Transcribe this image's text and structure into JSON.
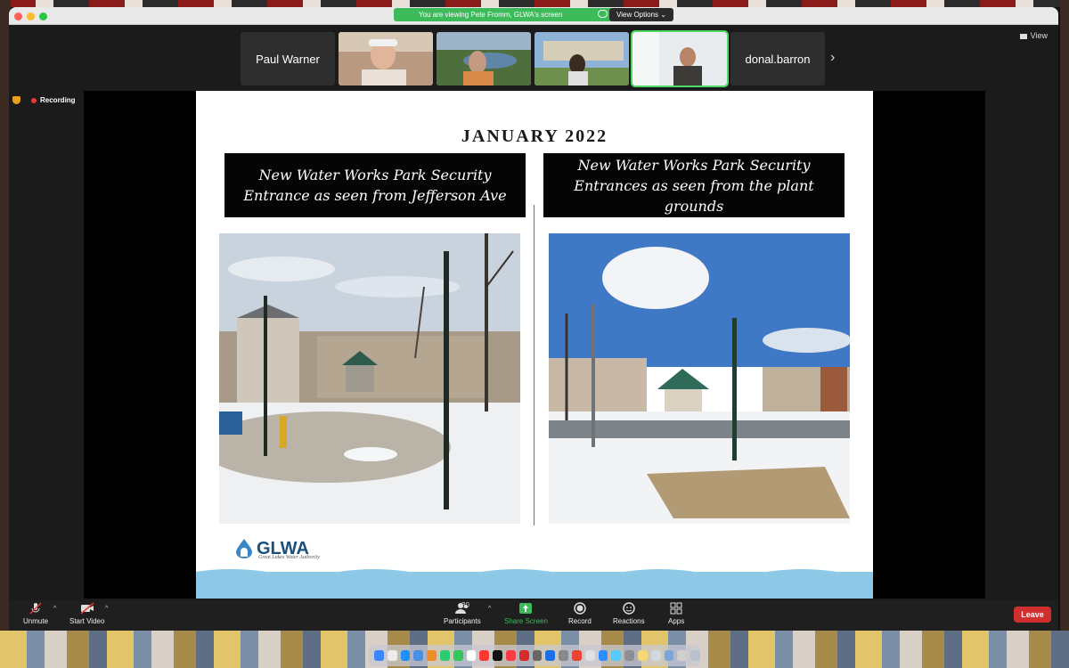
{
  "screen_share": {
    "banner_text": "You are viewing Pete Fromm, GLWA's screen",
    "view_options_label": "View Options ⌄"
  },
  "participants": [
    {
      "type": "name",
      "label": "Paul Warner"
    },
    {
      "type": "video",
      "label": ""
    },
    {
      "type": "video",
      "label": ""
    },
    {
      "type": "video",
      "label": ""
    },
    {
      "type": "video",
      "label": "",
      "active": true
    },
    {
      "type": "name",
      "label": "donal.barron"
    }
  ],
  "view_label": "View",
  "recording_label": "Recording",
  "slide": {
    "title": "JANUARY 2022",
    "left_caption_line1": "New Water Works Park Security",
    "left_caption_line2": "Entrance as seen from Jefferson Ave",
    "right_caption_line1": "New Water Works Park Security",
    "right_caption_line2": "Entrances as seen from the plant grounds",
    "logo_text": "GLWA",
    "logo_subtitle": "Great Lakes Water Authority"
  },
  "toolbar": {
    "unmute": "Unmute",
    "start_video": "Start Video",
    "participants": "Participants",
    "participant_count": "30",
    "share_screen": "Share Screen",
    "record": "Record",
    "reactions": "Reactions",
    "apps": "Apps",
    "leave": "Leave"
  },
  "colors": {
    "share_green": "#3dbb5b",
    "leave_red": "#d12f2f",
    "glwa_blue": "#1c4f7a",
    "slide_wave": "#8dc9e6"
  },
  "icons": [
    "microphone-muted-icon",
    "video-off-icon",
    "participants-icon",
    "share-screen-icon",
    "record-icon",
    "reactions-icon",
    "apps-icon",
    "shield-icon",
    "cloud-icon",
    "chevron-right-icon"
  ]
}
